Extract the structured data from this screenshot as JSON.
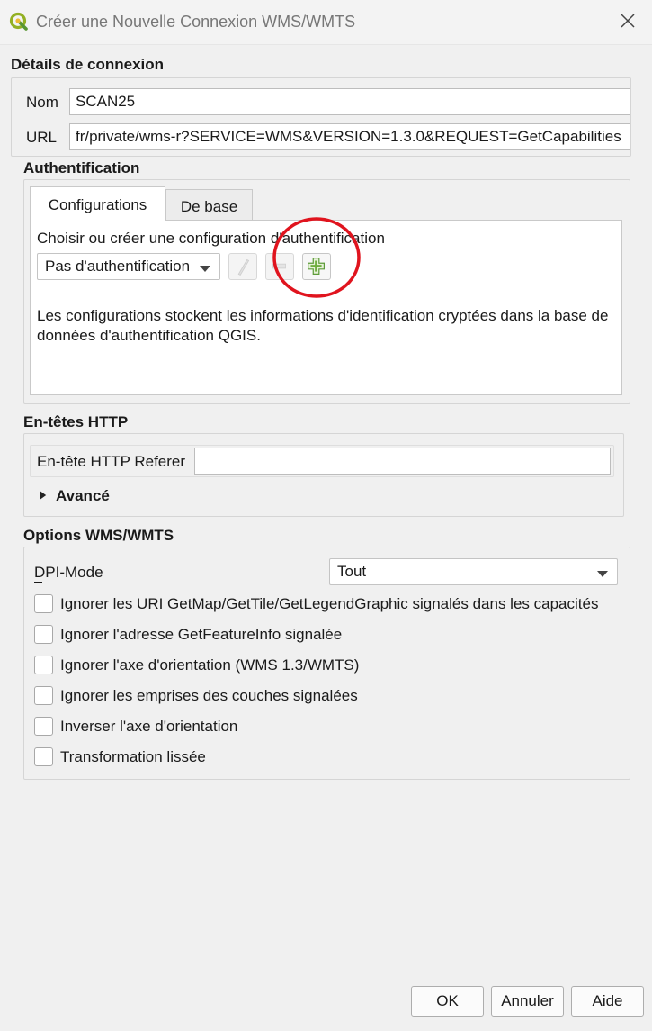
{
  "window": {
    "title": "Créer une Nouvelle Connexion WMS/WMTS",
    "app_icon": "qgis-logo-icon",
    "close_icon": "close-icon"
  },
  "connection": {
    "heading": "Détails de connexion",
    "name_label": "Nom",
    "name_value": "SCAN25",
    "url_label": "URL",
    "url_value": "fr/private/wms-r?SERVICE=WMS&VERSION=1.3.0&REQUEST=GetCapabilities"
  },
  "auth": {
    "heading": "Authentification",
    "tabs": [
      {
        "label": "Configurations",
        "active": true
      },
      {
        "label": "De base",
        "active": false
      }
    ],
    "prompt": "Choisir ou créer une configuration d'authentification",
    "combo_value": "Pas d'authentification",
    "buttons": [
      {
        "name": "edit-config-button",
        "icon": "pencil-icon",
        "enabled": false
      },
      {
        "name": "remove-config-button",
        "icon": "minus-icon",
        "enabled": false
      },
      {
        "name": "add-config-button",
        "icon": "green-plus-icon",
        "enabled": true
      }
    ],
    "info_text": "Les configurations stockent les informations d'identification cryptées dans la base de données d'authentification QGIS.",
    "highlight_color": "#e0141e"
  },
  "http": {
    "heading": "En-têtes HTTP",
    "referer_label": "En-tête HTTP Referer",
    "referer_value": "",
    "advanced_label": "Avancé"
  },
  "wms": {
    "heading": "Options WMS/WMTS",
    "dpi_label": "DPI-Mode",
    "dpi_value": "Tout",
    "options": [
      {
        "label": "Ignorer les URI GetMap/GetTile/GetLegendGraphic signalés dans les capacités",
        "checked": false
      },
      {
        "label": "Ignorer l'adresse GetFeatureInfo signalée",
        "checked": false
      },
      {
        "label": "Ignorer l'axe d'orientation (WMS 1.3/WMTS)",
        "checked": false
      },
      {
        "label": "Ignorer les emprises des couches signalées",
        "checked": false
      },
      {
        "label": "Inverser l'axe d'orientation",
        "checked": false
      },
      {
        "label": "Transformation lissée",
        "checked": false
      }
    ]
  },
  "footer": {
    "ok_label": "OK",
    "cancel_label": "Annuler",
    "help_label": "Aide"
  }
}
